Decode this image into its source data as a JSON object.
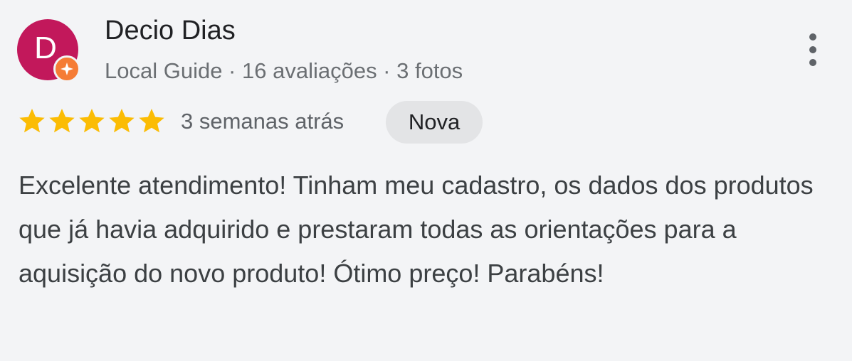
{
  "review": {
    "avatar_letter": "D",
    "avatar_color": "#c2185b",
    "badge_icon": "local-guide-star-icon",
    "badge_color": "#f57c35",
    "reviewer_name": "Decio Dias",
    "reviewer_meta": "Local Guide · 16 avaliações · 3 fotos",
    "menu_icon": "more-vertical-icon",
    "rating": 5,
    "rating_max": 5,
    "star_color": "#fbbc04",
    "time_ago": "3 semanas atrás",
    "new_badge_label": "Nova",
    "text": "Excelente atendimento! Tinham meu cadastro, os dados dos produtos que já havia adquirido e prestaram todas as orientações para a aquisição do novo produto! Ótimo preço! Parabéns!"
  }
}
